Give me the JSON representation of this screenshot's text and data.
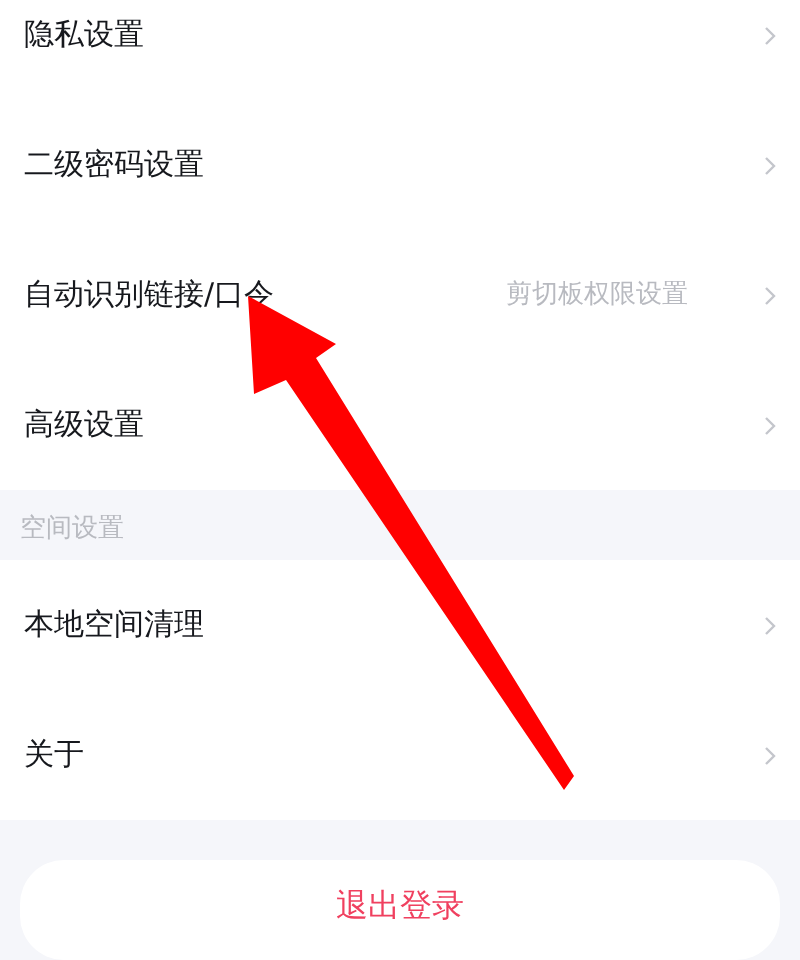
{
  "sections": [
    {
      "items": [
        {
          "label": "隐私设置"
        },
        {
          "label": "二级密码设置"
        },
        {
          "label": "自动识别链接/口令",
          "value": "剪切板权限设置"
        },
        {
          "label": "高级设置"
        }
      ]
    },
    {
      "header": "空间设置",
      "items": [
        {
          "label": "本地空间清理"
        },
        {
          "label": "关于"
        }
      ]
    }
  ],
  "logout_button": {
    "label": "退出登录"
  }
}
